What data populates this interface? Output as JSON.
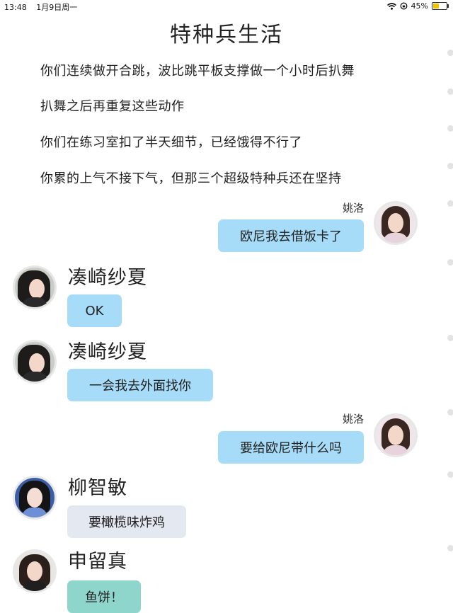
{
  "status_bar": {
    "time": "13:48",
    "date": "1月9日周一",
    "battery_text": "45%",
    "battery_level": 0.45
  },
  "title": "特种兵生活",
  "narration": [
    "你们连续做开合跳，波比跳平板支撑做一个小时后扒舞",
    "扒舞之后再重复这些动作",
    "你们在练习室扣了半天细节，已经饿得不行了",
    "你累的上气不接下气，但那三个超级特种兵还在坚持"
  ],
  "messages": [
    {
      "side": "right",
      "sender": "姚洛",
      "text": "欧尼我去借饭卡了"
    },
    {
      "side": "left",
      "sender": "凑崎纱夏",
      "text": "OK"
    },
    {
      "side": "left",
      "sender": "凑崎纱夏",
      "text": "一会我去外面找你"
    },
    {
      "side": "right",
      "sender": "姚洛",
      "text": "要给欧尼带什么吗"
    },
    {
      "side": "left",
      "sender": "柳智敏",
      "text": "要橄榄味炸鸡"
    },
    {
      "side": "left",
      "sender": "申留真",
      "text": "鱼饼！"
    }
  ],
  "colors": {
    "bubble_blue": "#a7dcf8",
    "bubble_gray": "#e4e8f0",
    "bubble_teal": "#8ed5cc",
    "battery_fill": "#f2c200"
  }
}
